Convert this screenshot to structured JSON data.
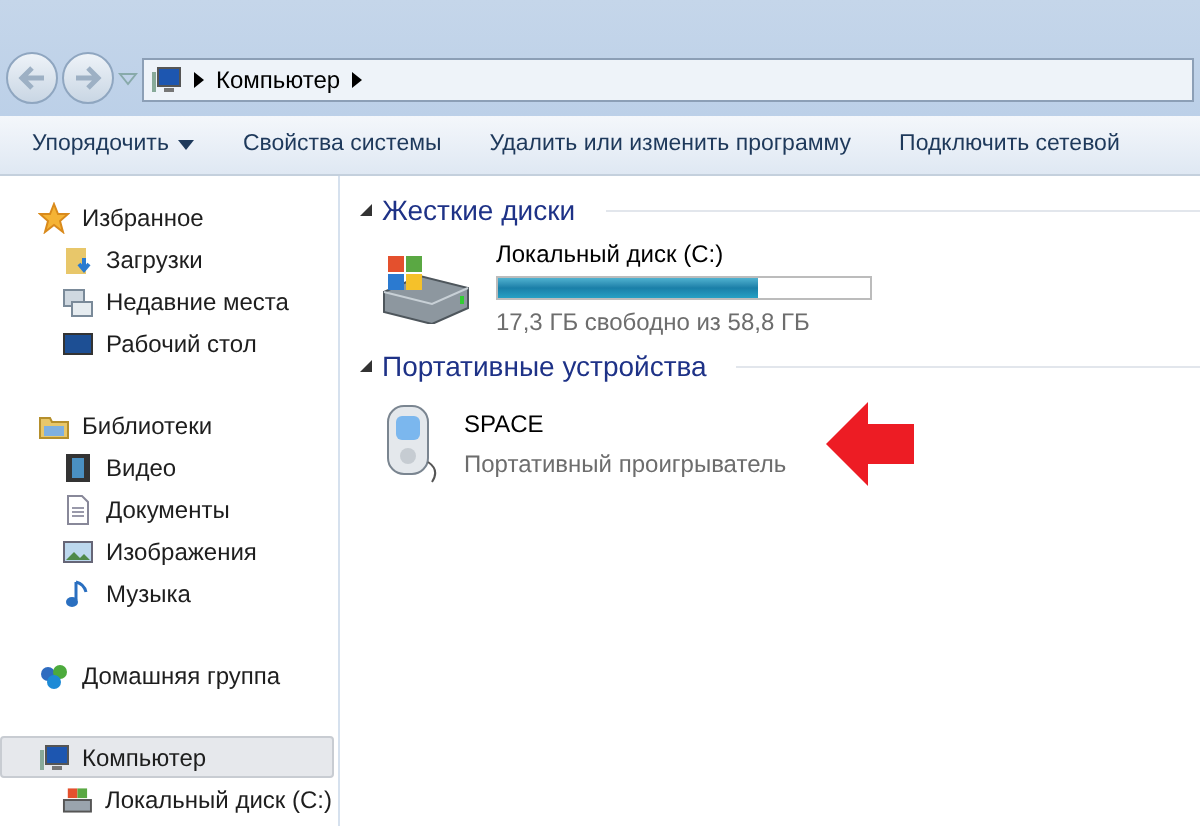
{
  "address_bar": {
    "path": [
      {
        "label": "Компьютер"
      }
    ]
  },
  "toolbar": [
    {
      "label": "Упорядочить",
      "kind": "menu"
    },
    {
      "label": "Свойства системы",
      "kind": "button"
    },
    {
      "label": "Удалить или изменить программу",
      "kind": "button"
    },
    {
      "label": "Подключить сетевой",
      "kind": "button"
    }
  ],
  "sidebar": {
    "groups": [
      {
        "label": "Избранное",
        "kind": "star",
        "selected": false,
        "children": [
          {
            "label": "Загрузки",
            "kind": "downloads",
            "selected": false
          },
          {
            "label": "Недавние места",
            "kind": "recent",
            "selected": false
          },
          {
            "label": "Рабочий стол",
            "kind": "desktop",
            "selected": false
          }
        ]
      },
      {
        "label": "Библиотеки",
        "kind": "library",
        "selected": false,
        "children": [
          {
            "label": "Видео",
            "kind": "video",
            "selected": false
          },
          {
            "label": "Документы",
            "kind": "document",
            "selected": false
          },
          {
            "label": "Изображения",
            "kind": "image",
            "selected": false
          },
          {
            "label": "Музыка",
            "kind": "music",
            "selected": false
          }
        ]
      },
      {
        "label": "Домашняя группа",
        "kind": "homegroup",
        "selected": false
      },
      {
        "label": "Компьютер",
        "kind": "computer",
        "selected": true,
        "children": [
          {
            "label": "Локальный диск (C:)",
            "kind": "drive",
            "selected": false
          }
        ]
      }
    ]
  },
  "sections": [
    {
      "title": "Жесткие диски",
      "expanded": true,
      "items": [
        {
          "kind": "drive",
          "name": "Локальный диск (C:)",
          "level": 0.7,
          "detail": "17,3 ГБ свободно из 58,8 ГБ"
        }
      ]
    },
    {
      "title": "Портативные устройства",
      "expanded": true,
      "items": [
        {
          "kind": "device",
          "name": "SPACE",
          "detail": "Портативный проигрыватель"
        }
      ]
    }
  ]
}
